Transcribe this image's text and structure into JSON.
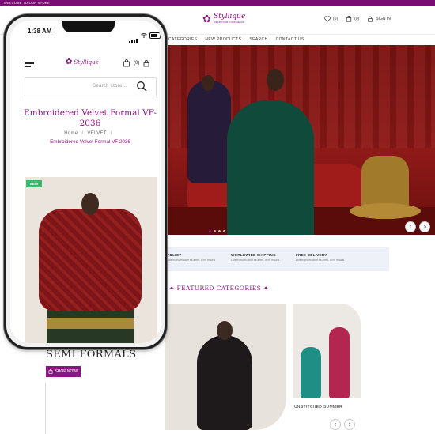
{
  "desktop": {
    "announcement": "WELCOME TO OUR STORE",
    "logo": {
      "name": "Styllique",
      "tagline": "WEAR YOUR CONFIDENCE"
    },
    "header": {
      "wishlist_count": "(0)",
      "cart_count": "(0)",
      "signin": "SIGN IN"
    },
    "nav": [
      "CATEGORIES",
      "NEW PRODUCTS",
      "SEARCH",
      "CONTACT US"
    ],
    "hero": {
      "prev": "‹",
      "next": "›",
      "slides": 4,
      "active_slide": 1
    },
    "features": [
      {
        "title": "POLICY",
        "desc": "Lorem ipsum dolor sit amet, ut mi mauris"
      },
      {
        "title": "WORLDWIDE SHIPPING",
        "desc": "Lorem ipsum dolor sit amet, ut mi mauris"
      },
      {
        "title": "FREE DELIVERY",
        "desc": "Lorem ipsum dolor sit amet, ut mi mauris"
      }
    ],
    "featured_title": "FEATURED CATEGORIES",
    "semi_formals": "SEMI FORMALS",
    "shop_now": "SHOP NOW!",
    "card2_label": "UNSTITCHED SUMMER",
    "pager": {
      "prev": "‹",
      "next": "›"
    }
  },
  "phone": {
    "time": "1:38 AM",
    "logo": {
      "name": "Styllique"
    },
    "cart_count": "(0)",
    "search_placeholder": "Search store...",
    "product_title": "Embroidered Velvet Formal VF-2036",
    "breadcrumb": {
      "home": "Home",
      "category": "VELVET",
      "current": "Embroidered Velvet Formal VF 2036"
    },
    "badge": "NEW"
  },
  "colors": {
    "brand": "#8a1681",
    "new_badge": "#3cb86d",
    "feature_bar": "#eef1f8"
  }
}
